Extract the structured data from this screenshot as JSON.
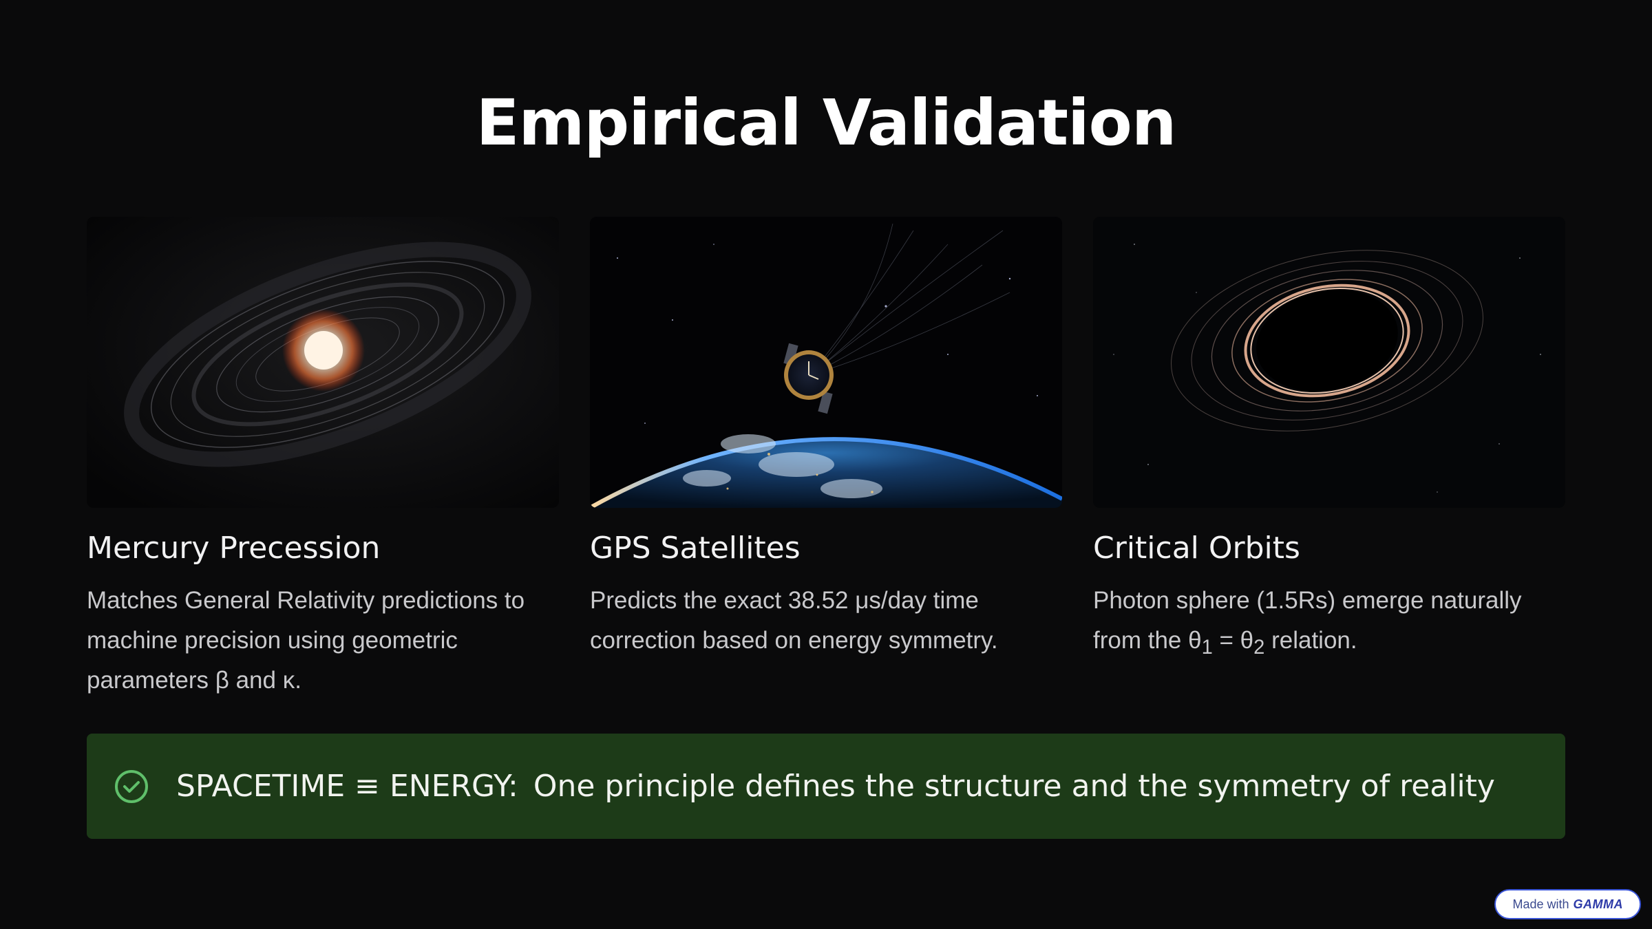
{
  "slide": {
    "title": "Empirical Validation"
  },
  "cards": [
    {
      "title": "Mercury Precession",
      "description": "Matches General Relativity predictions to machine precision using geometric parameters β and κ.",
      "image_icon": "sun-orbit-rings-icon"
    },
    {
      "title": "GPS Satellites",
      "description": "Predicts the exact 38.52 μs/day time correction based on energy symmetry.",
      "image_icon": "satellite-clock-earth-icon"
    },
    {
      "title": "Critical Orbits",
      "description_parts": {
        "before": "Photon sphere (1.5Rs) emerge naturally from the θ",
        "sub1": "1",
        "middle": " = θ",
        "sub2": "2",
        "after": " relation."
      },
      "image_icon": "black-hole-photon-ring-icon"
    }
  ],
  "callout": {
    "label": "SPACETIME ≡ ENERGY:",
    "text": "One principle defines the structure and the symmetry of reality",
    "icon": "check-circle-icon",
    "accent_color": "#5fbf6a",
    "background_color": "#1d3b18"
  },
  "badge": {
    "prefix": "Made with",
    "brand": "GAMMA"
  }
}
